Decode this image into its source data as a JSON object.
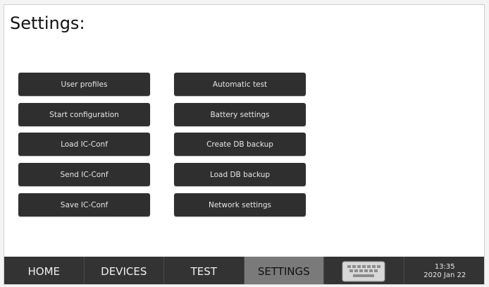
{
  "page": {
    "title": "Settings:"
  },
  "buttons": {
    "left": [
      {
        "label": "User profiles"
      },
      {
        "label": "Start configuration"
      },
      {
        "label": "Load IC-Conf"
      },
      {
        "label": "Send IC-Conf"
      },
      {
        "label": "Save IC-Conf"
      }
    ],
    "right": [
      {
        "label": "Automatic test"
      },
      {
        "label": "Battery settings"
      },
      {
        "label": "Create DB backup"
      },
      {
        "label": "Load DB backup"
      },
      {
        "label": "Network settings"
      }
    ]
  },
  "bottom_bar": {
    "tabs": [
      {
        "label": "HOME"
      },
      {
        "label": "DEVICES"
      },
      {
        "label": "TEST"
      },
      {
        "label": "SETTINGS"
      }
    ],
    "active_tab": "SETTINGS",
    "keyboard_icon": "keyboard-icon",
    "clock": {
      "time": "13:35",
      "date": "2020 Jan 22"
    }
  },
  "colors": {
    "button_bg": "#2f2f2f",
    "bar_bg": "#333333",
    "active_tab_bg": "#7a7a7a"
  }
}
